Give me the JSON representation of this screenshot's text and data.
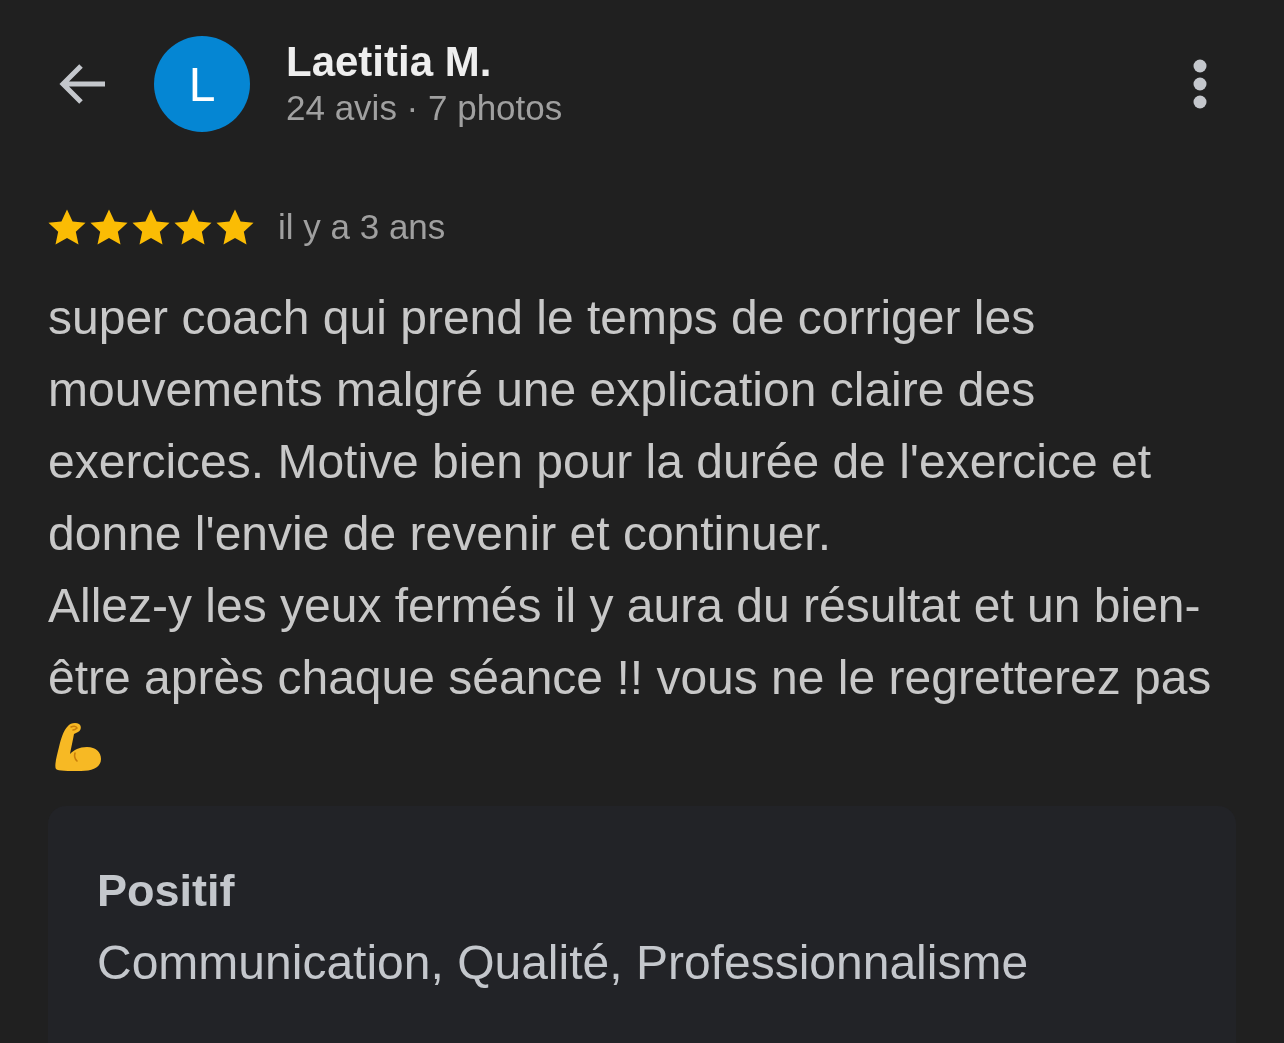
{
  "header": {
    "avatar": {
      "initial": "L"
    },
    "name": "Laetitia M.",
    "stats": "24 avis · 7 photos"
  },
  "review": {
    "stars": 5,
    "time": "il y a 3 ans",
    "text": "super coach qui prend le temps de corriger les mouvements malgré une explication claire des exercices. Motive bien pour la durée de l'exercice et donne l'envie de revenir et continuer.\nAllez-y les yeux fermés il y aura du résultat et un bien-être après chaque séance !! vous ne le regretterez pas"
  },
  "highlights": {
    "title": "Positif",
    "text": "Communication, Qualité, Professionnalisme"
  }
}
